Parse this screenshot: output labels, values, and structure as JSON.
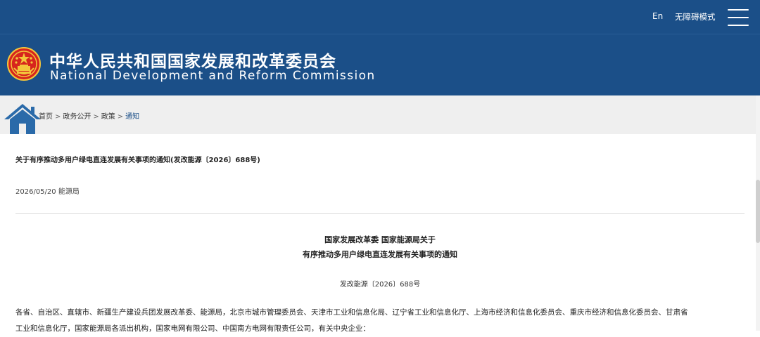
{
  "topbar": {
    "lang_label": "En",
    "accessibility_label": "无障碍模式"
  },
  "header": {
    "title_cn": "中华人民共和国国家发展和改革委员会",
    "title_en": "National Development and Reform Commission"
  },
  "breadcrumb": {
    "items": [
      {
        "label": "首页"
      },
      {
        "label": "政务公开"
      },
      {
        "label": "政策"
      },
      {
        "label": "通知"
      }
    ],
    "separator": ">"
  },
  "article": {
    "title": "关于有序推动多用户绿电直连发展有关事项的通知(发改能源〔2026〕688号)",
    "meta": "2026/05/20 能源局",
    "heading_line1": "国家发展改革委  国家能源局关于",
    "heading_line2": "有序推动多用户绿电直连发展有关事项的通知",
    "doc_number": "发改能源〔2026〕688号",
    "body_line1": "各省、自治区、直辖市、新疆生产建设兵团发展改革委、能源局，北京市城市管理委员会、天津市工业和信息化局、辽宁省工业和信息化厅、上海市经济和信息化委员会、重庆市经济和信息化委员会、甘肃省",
    "body_line2": "工业和信息化厅，国家能源局各派出机构，国家电网有限公司、中国南方电网有限责任公司，有关中央企业："
  },
  "colors": {
    "header_blue": "#1b4f88",
    "breadcrumb_bg": "#efefef",
    "emblem_red": "#d7251d",
    "emblem_gold": "#f3c53b"
  }
}
